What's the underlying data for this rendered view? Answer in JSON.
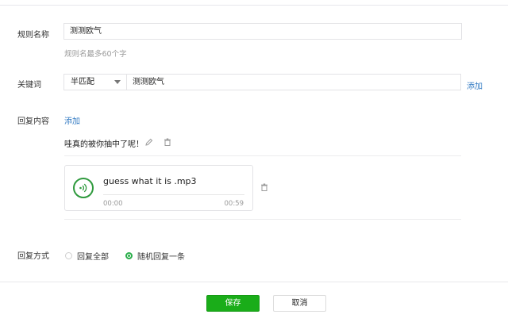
{
  "rule_name": {
    "label": "规则名称",
    "value": "测测欧气",
    "hint": "规则名最多60个字"
  },
  "keyword": {
    "label": "关键词",
    "match_mode": "半匹配",
    "value": "测测欧气",
    "add_link": "添加"
  },
  "reply_content": {
    "label": "回复内容",
    "add_link": "添加",
    "text_reply": "哇真的被你抽中了呢！",
    "audio": {
      "title": "guess what it is .mp3",
      "current_time": "00:00",
      "duration": "00:59",
      "progress": 0
    }
  },
  "reply_mode": {
    "label": "回复方式",
    "options": [
      "回复全部",
      "随机回复一条"
    ],
    "selected": "随机回复一条"
  },
  "actions": {
    "save_label": "保存",
    "cancel_label": "取消"
  },
  "colors": {
    "accent_green": "#1aad19",
    "link_blue": "#2f78c2"
  },
  "icons": [
    "pencil-icon",
    "trash-icon",
    "audio-wave-icon",
    "chevron-down-icon"
  ]
}
